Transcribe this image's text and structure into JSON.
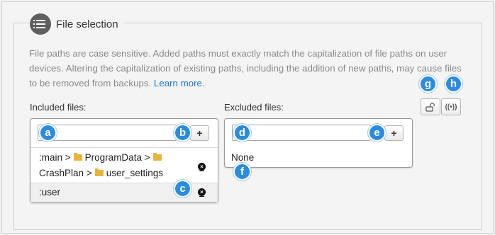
{
  "section": {
    "title": "File selection",
    "description": "File paths are case sensitive. Added paths must exactly match the capitalization of file paths on user devices. Altering the capitalization of existing paths, including the addition of new paths, may cause files to be removed from backups.",
    "learn_more": "Learn more."
  },
  "included": {
    "label": "Included files:",
    "add_label": "+",
    "paths": [
      {
        "line1": [
          ":main",
          ">",
          "ProgramData",
          ">"
        ],
        "line2": [
          "CrashPlan",
          ">",
          "user_settings"
        ],
        "remove": "×"
      },
      {
        "text": ":user",
        "remove": "×"
      }
    ]
  },
  "excluded": {
    "label": "Excluded files:",
    "add_label": "+",
    "empty_text": "None"
  },
  "toolbar": {
    "lock_icon": "unlock-icon",
    "broadcast_icon": "broadcast-icon",
    "broadcast_glyph": "((•))"
  },
  "callouts": [
    "a",
    "b",
    "c",
    "d",
    "e",
    "f",
    "g",
    "h"
  ],
  "colors": {
    "callout": "#2b8be0",
    "link": "#1a73d6",
    "folder": "#e9b43b"
  }
}
